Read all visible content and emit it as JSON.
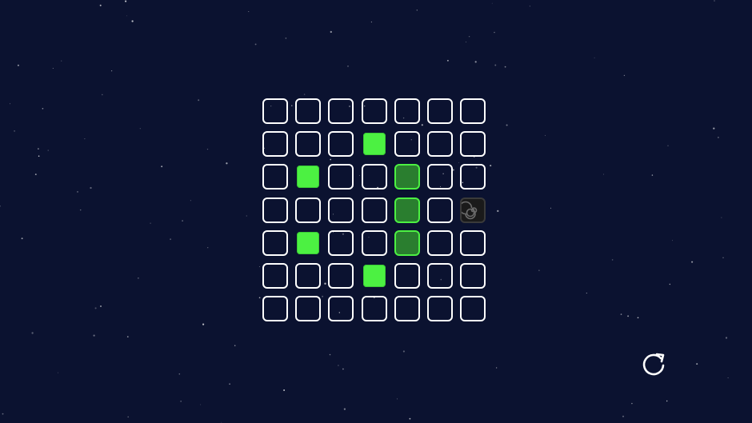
{
  "board": {
    "rows": 7,
    "cols": 7,
    "lit_cells": [
      [
        1,
        3
      ],
      [
        2,
        1
      ],
      [
        4,
        1
      ],
      [
        5,
        3
      ]
    ],
    "dim_cells": [
      [
        2,
        4
      ],
      [
        3,
        4
      ],
      [
        4,
        4
      ]
    ],
    "portal_cell": [
      3,
      6
    ]
  },
  "icons": {
    "portal": "spiral-vortex-icon",
    "restart": "restart-arrow-icon"
  },
  "colors": {
    "background": "#0b1230",
    "cell_border": "#ffffff",
    "lit": "#4cf142",
    "dim_fill": "#2a7e2f",
    "dim_border": "#4cf142",
    "portal_bg": "#1a1a1a"
  }
}
